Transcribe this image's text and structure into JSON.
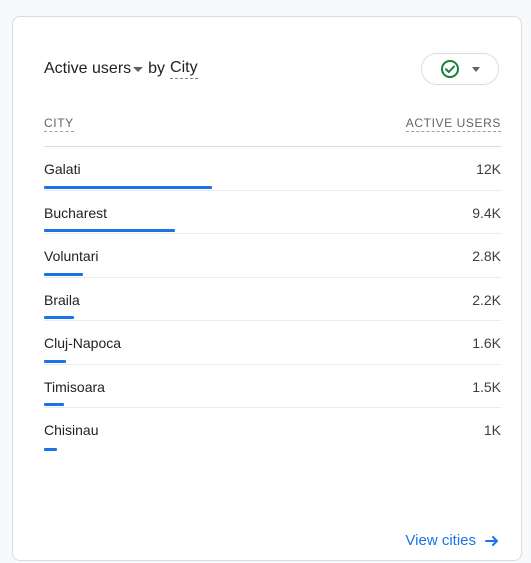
{
  "card": {
    "metric": "Active users",
    "by": "by",
    "dimension": "City",
    "status_color": "#188038",
    "footer_link": "View cities"
  },
  "table": {
    "columns": [
      "CITY",
      "ACTIVE USERS"
    ],
    "rows": [
      {
        "city": "Galati",
        "value": "12K",
        "share": 1.0
      },
      {
        "city": "Bucharest",
        "value": "9.4K",
        "share": 0.78
      },
      {
        "city": "Voluntari",
        "value": "2.8K",
        "share": 0.23
      },
      {
        "city": "Braila",
        "value": "2.2K",
        "share": 0.18
      },
      {
        "city": "Cluj-Napoca",
        "value": "1.6K",
        "share": 0.13
      },
      {
        "city": "Timisoara",
        "value": "1.5K",
        "share": 0.12
      },
      {
        "city": "Chisinau",
        "value": "1K",
        "share": 0.08
      }
    ]
  },
  "colors": {
    "accent": "#1a73e8"
  }
}
